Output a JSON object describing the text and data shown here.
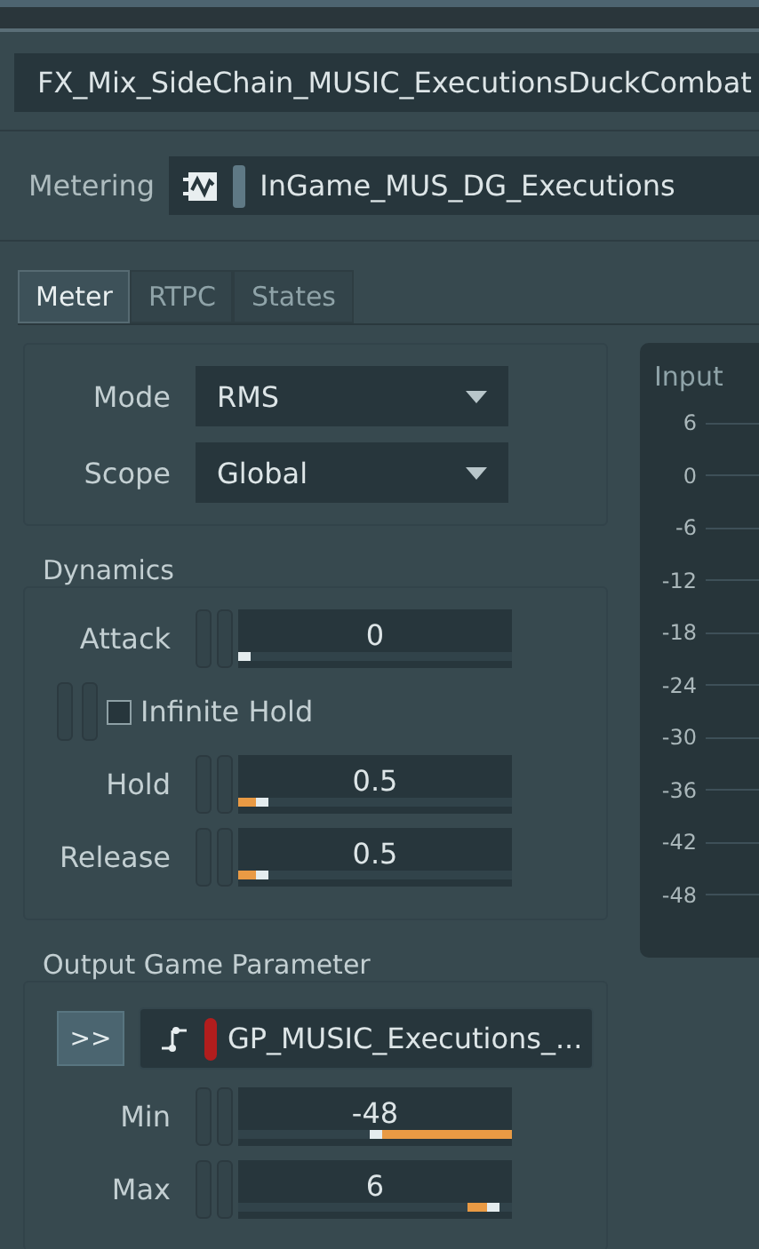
{
  "name_field": {
    "value": "FX_Mix_SideChain_MUSIC_ExecutionsDuckCombat"
  },
  "metering": {
    "label": "Metering",
    "value": "InGame_MUS_DG_Executions"
  },
  "tabs": [
    {
      "label": "Meter",
      "selected": true
    },
    {
      "label": "RTPC",
      "selected": false
    },
    {
      "label": "States",
      "selected": false
    }
  ],
  "settings": [
    {
      "label": "Mode",
      "value": "RMS"
    },
    {
      "label": "Scope",
      "value": "Global"
    }
  ],
  "dynamics": {
    "title": "Dynamics",
    "rows": [
      {
        "kind": "slider",
        "label": "Attack",
        "value": "0",
        "level": 0
      },
      {
        "kind": "checkbox",
        "label": "Infinite Hold",
        "checked": false
      },
      {
        "kind": "fillslider",
        "label": "Hold",
        "value": "0.5",
        "level": 0.07
      },
      {
        "kind": "fillslider",
        "label": "Release",
        "value": "0.5",
        "level": 0.07
      }
    ]
  },
  "output": {
    "title": "Output Game Parameter",
    "button": ">>",
    "parameter": "GP_MUSIC_Executions_...",
    "rows": [
      {
        "kind": "invslider",
        "label": "Min",
        "value": "-48",
        "level": 0.5
      },
      {
        "kind": "fillslider",
        "label": "Max",
        "value": "6",
        "level": 0.95
      }
    ]
  },
  "meter": {
    "title": "Input",
    "scale": [
      "6",
      "0",
      "-6",
      "-12",
      "-18",
      "-24",
      "-30",
      "-36",
      "-42",
      "-48"
    ]
  }
}
